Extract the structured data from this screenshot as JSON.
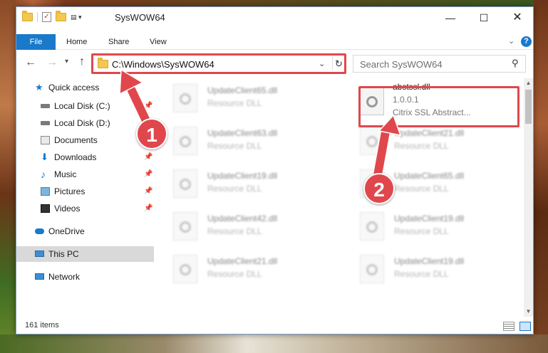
{
  "window": {
    "title": "SysWOW64",
    "controls": {
      "minimize": "—",
      "maximize": "☐",
      "close": "✕"
    }
  },
  "ribbon": {
    "tabs": [
      "File",
      "Home",
      "Share",
      "View"
    ]
  },
  "navigation": {
    "address": "C:\\Windows\\SysWOW64",
    "search_placeholder": "Search SysWOW64"
  },
  "sidebar": {
    "items": [
      {
        "label": "Quick access",
        "icon": "star-icon",
        "pinned": false
      },
      {
        "label": "Local Disk (C:)",
        "icon": "disk-icon",
        "pinned": true
      },
      {
        "label": "Local Disk (D:)",
        "icon": "disk-icon",
        "pinned": false
      },
      {
        "label": "Documents",
        "icon": "documents-icon",
        "pinned": true
      },
      {
        "label": "Downloads",
        "icon": "downloads-icon",
        "pinned": true
      },
      {
        "label": "Music",
        "icon": "music-icon",
        "pinned": true
      },
      {
        "label": "Pictures",
        "icon": "pictures-icon",
        "pinned": true
      },
      {
        "label": "Videos",
        "icon": "videos-icon",
        "pinned": true
      },
      {
        "label": "OneDrive",
        "icon": "onedrive-icon",
        "pinned": false
      },
      {
        "label": "This PC",
        "icon": "this-pc-icon",
        "pinned": false,
        "selected": true
      },
      {
        "label": "Network",
        "icon": "network-icon",
        "pinned": false
      }
    ]
  },
  "files": {
    "left_column": [
      {
        "name": "UpdateClient65.dll",
        "type": "Resource DLL"
      },
      {
        "name": "UpdateClient63.dll",
        "type": "Resource DLL"
      },
      {
        "name": "UpdateClient19.dll",
        "type": "Resource DLL"
      },
      {
        "name": "UpdateClient42.dll",
        "type": "Resource DLL"
      },
      {
        "name": "UpdateClient21.dll",
        "type": "Resource DLL"
      }
    ],
    "right_column": [
      {
        "name": "abstssl.dll",
        "version": "1.0.0.1",
        "description": "Citrix SSL Abstract..."
      },
      {
        "name": "UpdateClient21.dll",
        "type": "Resource DLL"
      },
      {
        "name": "UpdateClient65.dll",
        "type": "Resource DLL"
      },
      {
        "name": "UpdateClient19.dll",
        "type": "Resource DLL"
      },
      {
        "name": "UpdateClient19.dll",
        "type": "Resource DLL"
      }
    ]
  },
  "status": {
    "item_count": "161 items"
  },
  "callouts": {
    "step1": "1",
    "step2": "2",
    "color": "#e0474c"
  },
  "colors": {
    "accent": "#1979ca",
    "highlight": "#e0474c"
  }
}
